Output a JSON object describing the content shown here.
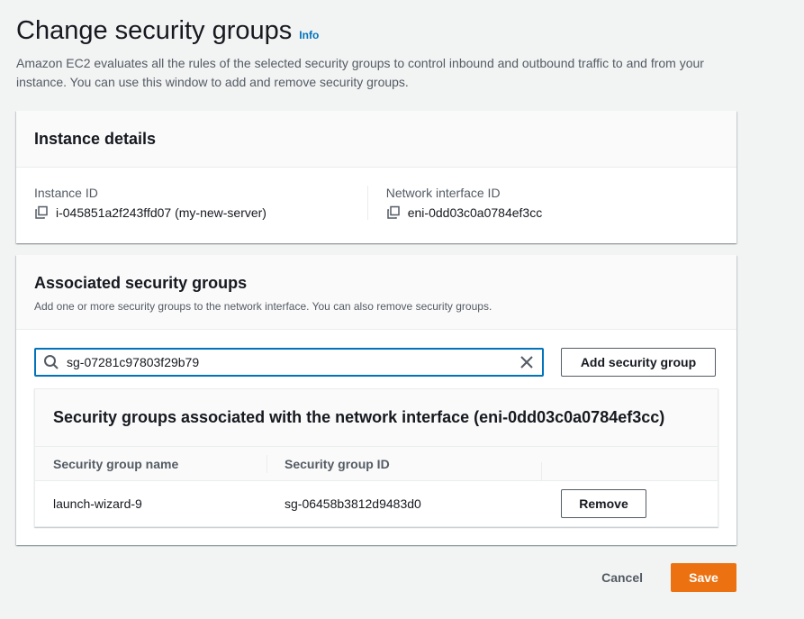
{
  "page": {
    "title": "Change security groups",
    "info_link": "Info",
    "description": "Amazon EC2 evaluates all the rules of the selected security groups to control inbound and outbound traffic to and from your instance. You can use this window to add and remove security groups."
  },
  "instance_details": {
    "title": "Instance details",
    "instance_id_label": "Instance ID",
    "instance_id_value": "i-045851a2f243ffd07 (my-new-server)",
    "network_interface_label": "Network interface ID",
    "network_interface_value": "eni-0dd03c0a0784ef3cc"
  },
  "security_groups": {
    "title": "Associated security groups",
    "description": "Add one or more security groups to the network interface. You can also remove security groups.",
    "search_value": "sg-07281c97803f29b79",
    "add_button": "Add security group",
    "table": {
      "title": "Security groups associated with the network interface (eni-0dd03c0a0784ef3cc)",
      "columns": [
        "Security group name",
        "Security group ID",
        ""
      ],
      "rows": [
        {
          "name": "launch-wizard-9",
          "id": "sg-06458b3812d9483d0",
          "action": "Remove"
        }
      ]
    }
  },
  "footer": {
    "cancel": "Cancel",
    "save": "Save"
  },
  "colors": {
    "accent": "#ec7211",
    "link": "#0073bb",
    "focus_border": "#0073bb",
    "background": "#f2f3f3"
  },
  "icons": {
    "copy": "copy-icon",
    "search": "search-icon",
    "clear": "close-icon"
  }
}
